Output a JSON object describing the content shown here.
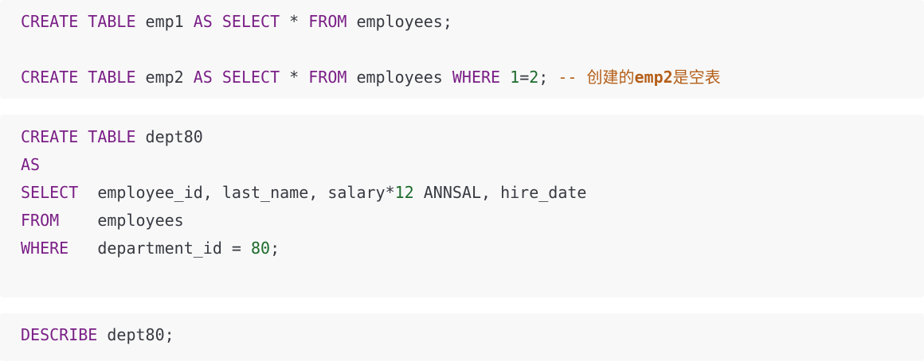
{
  "blocks": [
    {
      "lines": [
        [
          {
            "t": "CREATE TABLE",
            "c": "kw"
          },
          {
            "t": " emp1 ",
            "c": ""
          },
          {
            "t": "AS SELECT",
            "c": "kw"
          },
          {
            "t": " * ",
            "c": ""
          },
          {
            "t": "FROM",
            "c": "kw"
          },
          {
            "t": " employees;",
            "c": ""
          }
        ],
        [
          {
            "t": "CREATE TABLE",
            "c": "kw"
          },
          {
            "t": " emp2 ",
            "c": ""
          },
          {
            "t": "AS SELECT",
            "c": "kw"
          },
          {
            "t": " * ",
            "c": ""
          },
          {
            "t": "FROM",
            "c": "kw"
          },
          {
            "t": " employees ",
            "c": ""
          },
          {
            "t": "WHERE",
            "c": "kw"
          },
          {
            "t": " ",
            "c": ""
          },
          {
            "t": "1",
            "c": "num"
          },
          {
            "t": "=",
            "c": ""
          },
          {
            "t": "2",
            "c": "num"
          },
          {
            "t": "; ",
            "c": ""
          },
          {
            "t": "-- ",
            "c": "cm"
          },
          {
            "t": "创建的",
            "c": "cm cm-cjk"
          },
          {
            "t": "emp2",
            "c": "cm cm-bold"
          },
          {
            "t": "是空表",
            "c": "cm cm-cjk"
          }
        ]
      ]
    },
    {
      "lines": [
        [
          {
            "t": "CREATE TABLE",
            "c": "kw"
          },
          {
            "t": " dept80",
            "c": ""
          }
        ],
        [
          {
            "t": "AS",
            "c": "kw"
          }
        ],
        [
          {
            "t": "SELECT",
            "c": "kw"
          },
          {
            "t": "  employee_id, last_name, salary*",
            "c": ""
          },
          {
            "t": "12",
            "c": "num"
          },
          {
            "t": " ANNSAL, hire_date",
            "c": ""
          }
        ],
        [
          {
            "t": "FROM",
            "c": "kw"
          },
          {
            "t": "    employees",
            "c": ""
          }
        ],
        [
          {
            "t": "WHERE",
            "c": "kw"
          },
          {
            "t": "   department_id = ",
            "c": ""
          },
          {
            "t": "80",
            "c": "num"
          },
          {
            "t": ";",
            "c": ""
          }
        ]
      ]
    },
    {
      "lines": [
        [
          {
            "t": "DESCRIBE",
            "c": "kw"
          },
          {
            "t": " dept80;",
            "c": ""
          }
        ]
      ]
    }
  ]
}
